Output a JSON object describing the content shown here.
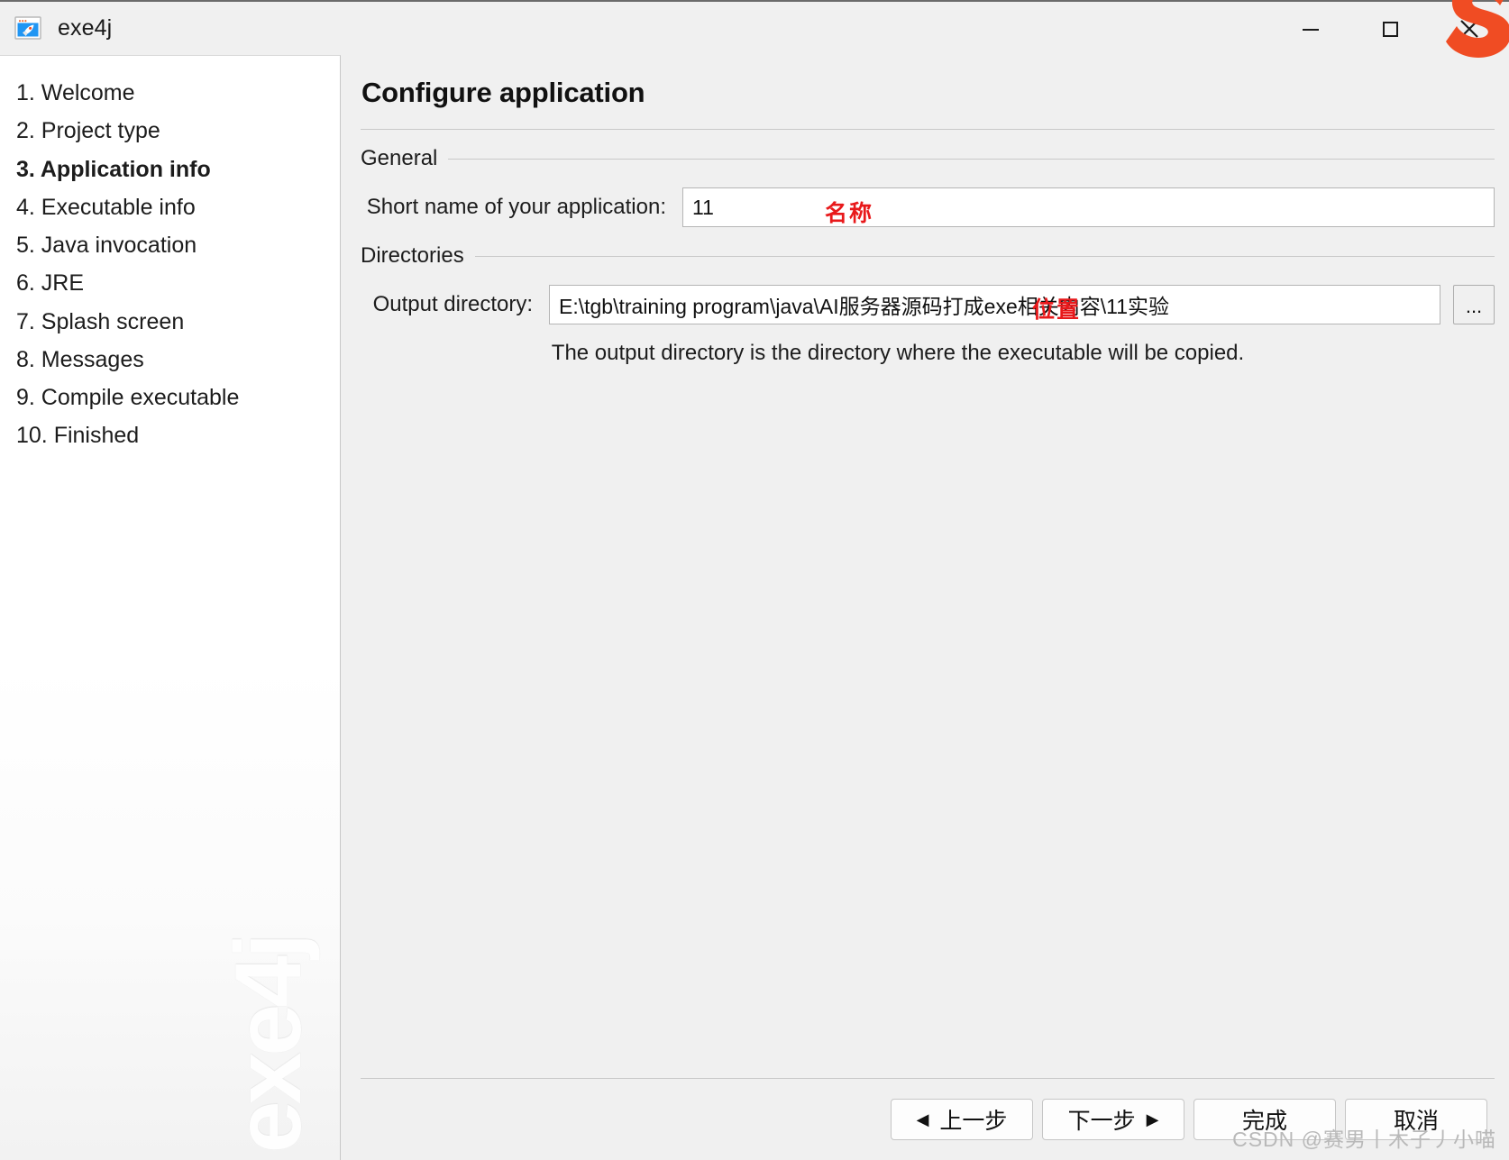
{
  "window": {
    "title": "exe4j",
    "icon": "rocket-window-icon",
    "controls": {
      "minimize": "–",
      "maximize": "□",
      "close": "✕"
    },
    "corner_logo": "orange-s-logo"
  },
  "sidebar": {
    "watermark": "exe4j",
    "items": [
      {
        "label": "1. Welcome",
        "active": false
      },
      {
        "label": "2. Project type",
        "active": false
      },
      {
        "label": "3. Application info",
        "active": true
      },
      {
        "label": "4. Executable info",
        "active": false
      },
      {
        "label": "5. Java invocation",
        "active": false
      },
      {
        "label": "6. JRE",
        "active": false
      },
      {
        "label": "7. Splash screen",
        "active": false
      },
      {
        "label": "8. Messages",
        "active": false
      },
      {
        "label": "9. Compile executable",
        "active": false
      },
      {
        "label": "10. Finished",
        "active": false
      }
    ]
  },
  "main": {
    "page_title": "Configure application",
    "general": {
      "group_label": "General",
      "short_name": {
        "label": "Short name of your application:",
        "value": "11",
        "placeholder": ""
      },
      "annotation": "名称"
    },
    "directories": {
      "group_label": "Directories",
      "output_directory": {
        "label": "Output directory:",
        "value": "E:\\tgb\\training program\\java\\AI服务器源码打成exe相关内容\\11实验",
        "placeholder": ""
      },
      "browse_label": "...",
      "hint": "The output directory is the directory where the executable will be copied.",
      "annotation": "位置"
    }
  },
  "buttons": {
    "back": {
      "label": "上一步",
      "arrow": "◀"
    },
    "next": {
      "label": "下一步",
      "arrow": "▶"
    },
    "finish": {
      "label": "完成"
    },
    "cancel": {
      "label": "取消"
    }
  },
  "footer": {
    "watermark": "CSDN @赛男丨木子丿小喵"
  },
  "colors": {
    "accent_red": "#e8191b",
    "window_bg": "#f0f0f0",
    "sidebar_bg": "#ffffff",
    "orange_logo": "#f04c23"
  }
}
